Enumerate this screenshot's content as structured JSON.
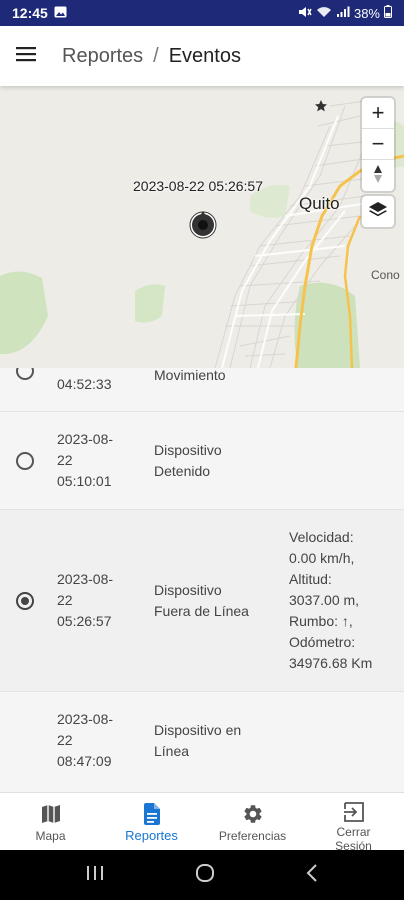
{
  "status_bar": {
    "time": "12:45",
    "battery": "38%"
  },
  "app_bar": {
    "crumb_parent": "Reportes",
    "separator": "/",
    "crumb_current": "Eventos"
  },
  "map": {
    "city_label": "Quito",
    "area_label": "Cono",
    "popup_text": "2023-08-22 05:26:57",
    "zoom_in": "+",
    "zoom_out": "−"
  },
  "events": [
    {
      "date_line1": "",
      "date_line2": "04:52:33",
      "type": "Movimiento",
      "attributes": ""
    },
    {
      "date_line1": "2023-08-",
      "date_line2": "22",
      "date_line3": "05:10:01",
      "type_line1": "Dispositivo",
      "type_line2": "Detenido",
      "icon": "radio-empty-icon"
    },
    {
      "date_line1": "2023-08-",
      "date_line2": "22",
      "date_line3": "05:26:57",
      "type_line1": "Dispositivo",
      "type_line2": "Fuera de Línea",
      "icon": "radio-selected-icon",
      "attrs": [
        "Velocidad:",
        "0.00 km/h,",
        "Altitud:",
        "3037.00 m,",
        "Rumbo: ↑,",
        "Odómetro:",
        "34976.68 Km"
      ]
    },
    {
      "date_line1": "2023-08-",
      "date_line2": "22",
      "date_line3": "08:47:09",
      "type_line1": "Dispositivo en",
      "type_line2": "Línea"
    }
  ],
  "bottom_nav": {
    "items": [
      {
        "label": "Mapa",
        "icon": "map-icon"
      },
      {
        "label": "Reportes",
        "icon": "document-icon"
      },
      {
        "label": "Preferencias",
        "icon": "gear-icon"
      },
      {
        "label_line1": "Cerrar",
        "label_line2": "Sesión",
        "icon": "logout-icon"
      }
    ]
  },
  "colors": {
    "status_bar": "#1e2a78",
    "accent": "#1976d2",
    "map_road": "#f5c34d"
  }
}
